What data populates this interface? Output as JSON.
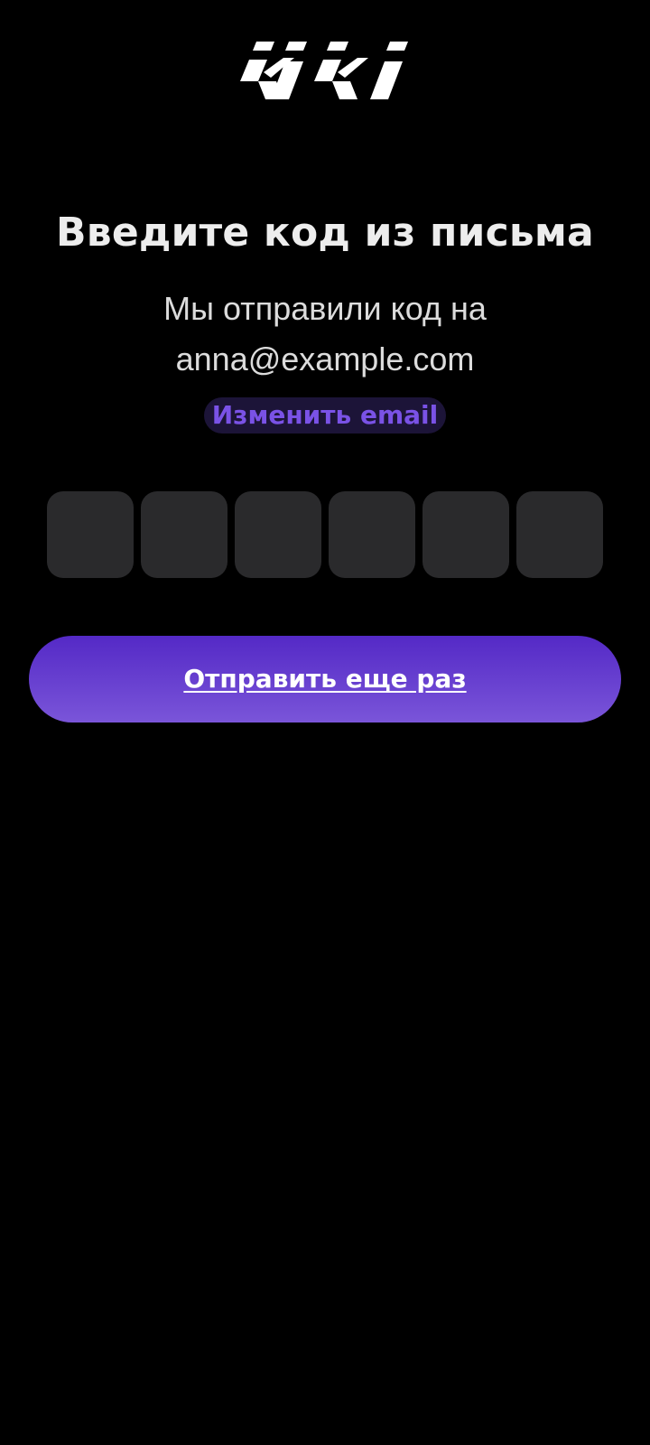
{
  "brand": {
    "logo_text": "kiki",
    "logo_color": "#ffffff"
  },
  "title": "Введите код из письма",
  "subtitle": {
    "line1": "Мы отправили код на",
    "email": "anna@example.com"
  },
  "change_email": {
    "label": "Изменить email",
    "color": "#7a52e6",
    "background": "#1c1438"
  },
  "code": {
    "cells": [
      "",
      "",
      "",
      "",
      "",
      ""
    ]
  },
  "resend": {
    "label": "Отправить еще раз",
    "gradient_top": "#5429c6",
    "gradient_bottom": "#7a55d9"
  },
  "theme": {
    "background": "#000000",
    "cell_background": "#2a2a2c",
    "text_primary": "#ededed"
  }
}
